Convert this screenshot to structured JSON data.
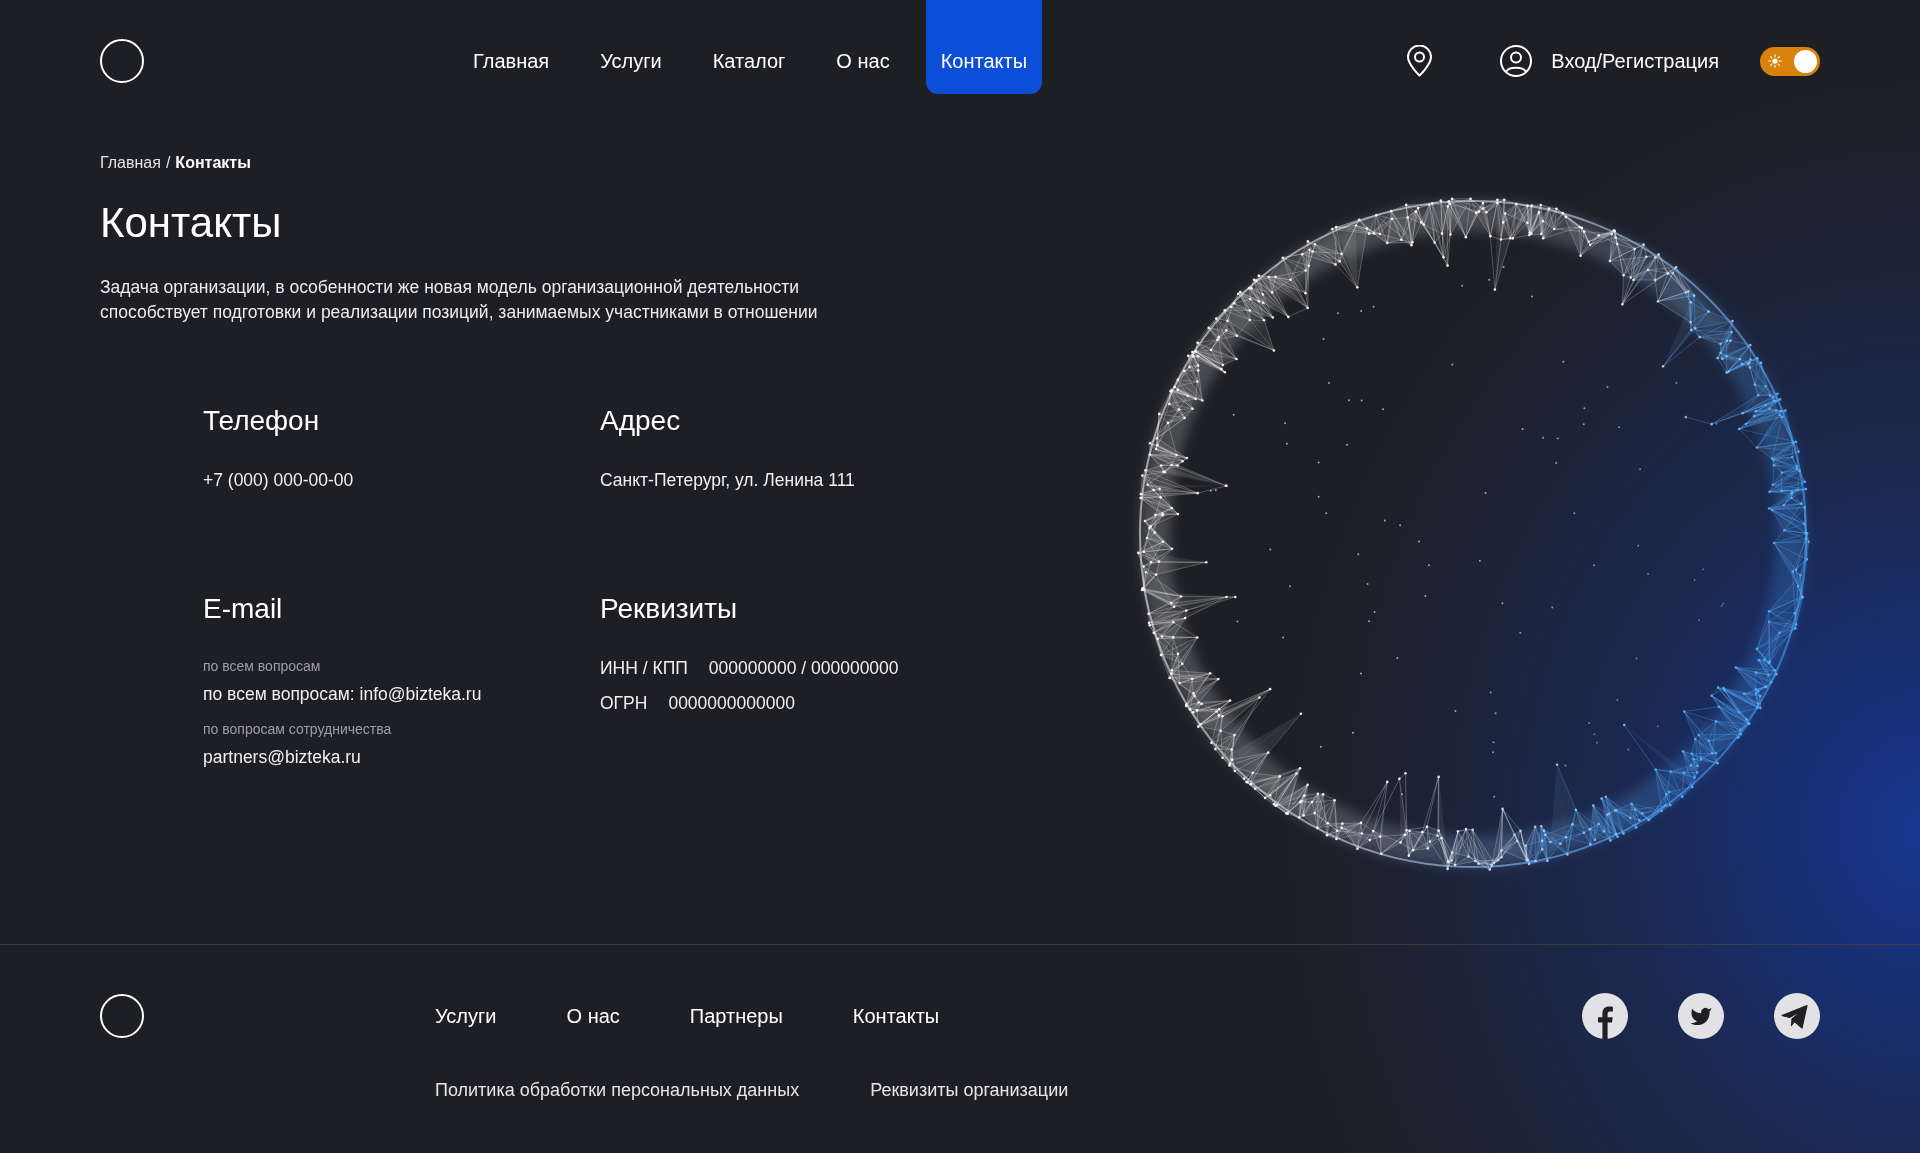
{
  "header": {
    "nav": [
      {
        "label": "Главная",
        "selected": false
      },
      {
        "label": "Услуги",
        "selected": false
      },
      {
        "label": "Каталог",
        "selected": false
      },
      {
        "label": "О нас",
        "selected": false
      },
      {
        "label": "Контакты",
        "selected": true
      }
    ],
    "login": "Вход/Регистрация",
    "theme_toggle": {
      "on": true
    }
  },
  "breadcrumb": {
    "items": [
      {
        "label": "Главная",
        "current": false
      },
      {
        "label": "Контакты",
        "current": true
      }
    ],
    "separator": "/"
  },
  "title": "Контакты",
  "intro": "Задача организации, в особенности же новая модель организационной деятельности способствует подготовки и реализации позиций, занимаемых участниками в отношении",
  "contacts": [
    {
      "kind": "phone",
      "heading": "Телефон",
      "value": "+7 (000) 000-00-00"
    },
    {
      "kind": "address",
      "heading": "Адрес",
      "value": "Санкт-Петерург, ул. Ленина 111"
    },
    {
      "kind": "email",
      "heading": "E-mail",
      "entries": [
        {
          "caption": "по всем вопросам",
          "value": "по всем вопросам: info@bizteka.ru"
        },
        {
          "caption": "по вопросам сотрудничества",
          "value": "partners@bizteka.ru"
        }
      ]
    },
    {
      "kind": "requisites",
      "heading": "Реквизиты",
      "rows": [
        {
          "label": "ИНН / КПП",
          "value": "000000000 / 000000000"
        },
        {
          "label": "ОГРН",
          "value": "0000000000000"
        }
      ]
    }
  ],
  "footer": {
    "nav": [
      "Услуги",
      "О нас",
      "Партнеры",
      "Контакты"
    ],
    "legal_links": [
      "Политика обработки персональных данных",
      "Реквизиты организации"
    ]
  }
}
